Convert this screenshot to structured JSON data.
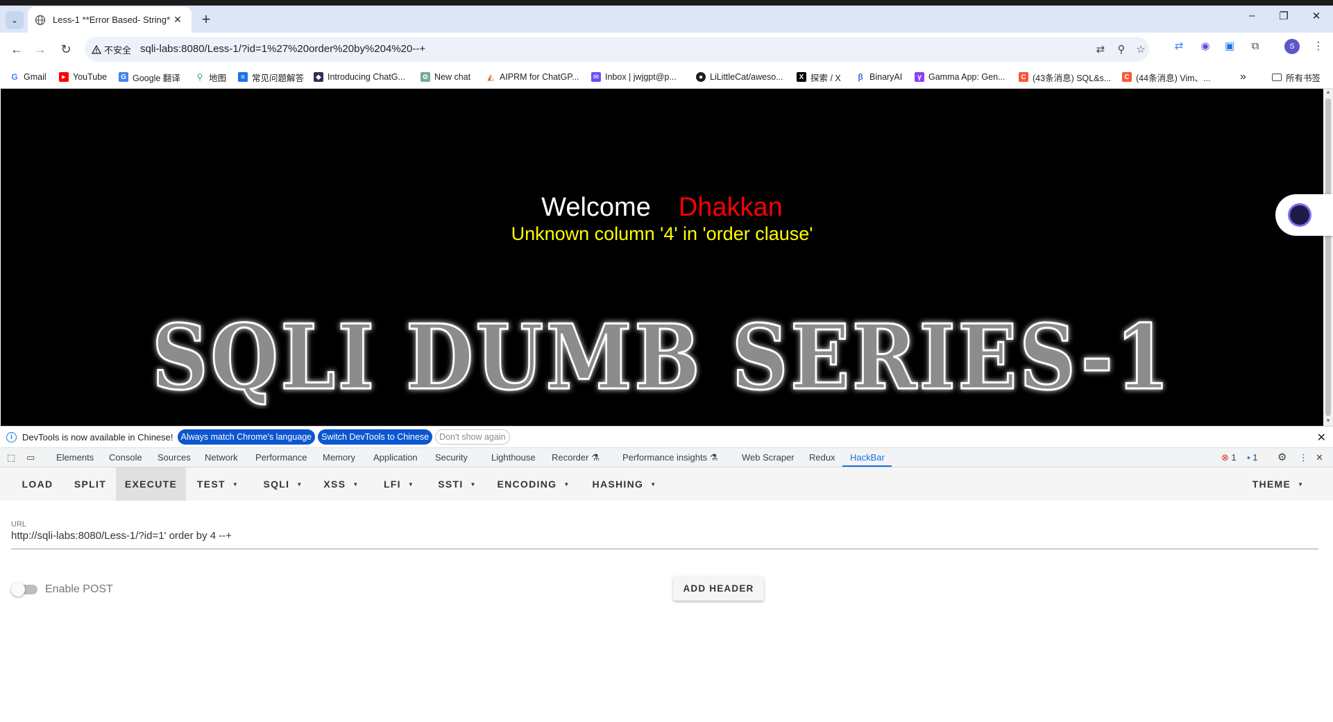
{
  "browser": {
    "tab_title": "Less-1 **Error Based- String**",
    "new_tab": "+",
    "insecure_label": "不安全",
    "url": "sqli-labs:8080/Less-1/?id=1%27%20order%20by%204%20--+",
    "window_controls": [
      "–",
      "❐",
      "✕"
    ]
  },
  "bookmarks": [
    {
      "label": "Gmail",
      "icon": "google-icon",
      "color": "#4285f4"
    },
    {
      "label": "YouTube",
      "icon": "youtube-icon",
      "color": "#ff0000"
    },
    {
      "label": "Google 翻译",
      "icon": "translate-icon",
      "color": "#4285f4"
    },
    {
      "label": "地图",
      "icon": "maps-icon",
      "color": "#34a853"
    },
    {
      "label": "常见问题解答",
      "icon": "faq-icon",
      "color": "#1a73e8"
    },
    {
      "label": "Introducing ChatG...",
      "icon": "chatgpt-icon",
      "color": "#3b2a5a"
    },
    {
      "label": "New chat",
      "icon": "openai-icon",
      "color": "#74aa9c"
    },
    {
      "label": "AIPRM for ChatGP...",
      "icon": "aiprm-icon",
      "color": "#e06c1e"
    },
    {
      "label": "Inbox | jwjgpt@p...",
      "icon": "proton-icon",
      "color": "#6d4aff"
    },
    {
      "label": "LiLittleCat/aweso...",
      "icon": "github-icon",
      "color": "#1f1f1f"
    },
    {
      "label": "探索 / X",
      "icon": "x-icon",
      "color": "#000000"
    },
    {
      "label": "BinaryAI",
      "icon": "binaryai-icon",
      "color": "#3b6ee8"
    },
    {
      "label": "Gamma App: Gen...",
      "icon": "gamma-icon",
      "color": "#8a3ffc"
    },
    {
      "label": "(43条消息) SQL&s...",
      "icon": "csdn-icon",
      "color": "#fc5531"
    },
    {
      "label": "(44条消息) Vim、...",
      "icon": "csdn-icon",
      "color": "#fc5531"
    }
  ],
  "bookmarks_overflow": "»",
  "bookmarks_all": "所有书签",
  "page": {
    "welcome": "Welcome",
    "name": "Dhakkan",
    "error": "Unknown column '4' in 'order clause'",
    "banner": "SQLI DUMB SERIES-1"
  },
  "devtools": {
    "info_text": "DevTools is now available in Chinese!",
    "btn_match": "Always match Chrome's language",
    "btn_switch": "Switch DevTools to Chinese",
    "btn_dont_show": "Don't show again",
    "tabs": [
      "Elements",
      "Console",
      "Sources",
      "Network",
      "Performance",
      "Memory",
      "Application",
      "Security",
      "Lighthouse",
      "Recorder ⚗",
      "Performance insights ⚗",
      "Web Scraper",
      "Redux",
      "HackBar"
    ],
    "error_count": "1",
    "message_count": "1"
  },
  "hackbar": {
    "menu": {
      "load": "LOAD",
      "split": "SPLIT",
      "execute": "EXECUTE",
      "test": "TEST",
      "sqli": "SQLI",
      "xss": "XSS",
      "lfi": "LFI",
      "ssti": "SSTI",
      "encoding": "ENCODING",
      "hashing": "HASHING",
      "theme": "THEME"
    },
    "url_label": "URL",
    "url_value": "http://sqli-labs:8080/Less-1/?id=1' order by 4 --+",
    "enable_post": "Enable POST",
    "post_enabled": false,
    "add_header": "ADD HEADER"
  }
}
